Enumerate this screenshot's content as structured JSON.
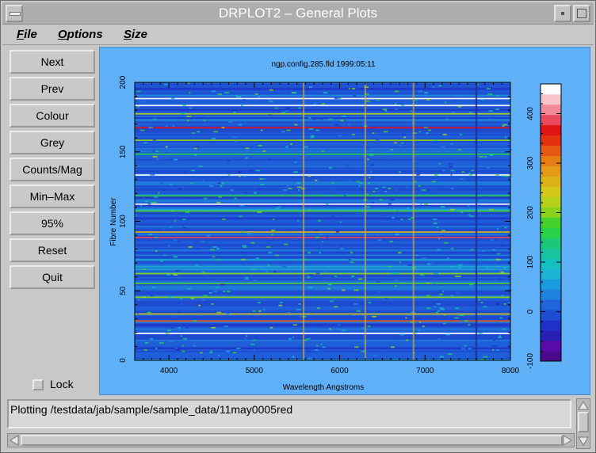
{
  "window": {
    "title": "DRPLOT2 – General Plots"
  },
  "menubar": [
    {
      "label": "File",
      "accel": "F",
      "rest": "ile"
    },
    {
      "label": "Options",
      "accel": "O",
      "rest": "ptions"
    },
    {
      "label": "Size",
      "accel": "S",
      "rest": "ize"
    }
  ],
  "buttons": [
    "Next",
    "Prev",
    "Colour",
    "Grey",
    "Counts/Mag",
    "Min–Max",
    "95%",
    "Reset",
    "Quit"
  ],
  "lock": {
    "label": "Lock",
    "checked": false
  },
  "status": {
    "text": "Plotting /testdata/jab/sample/sample_data/11may0005red"
  },
  "chart_data": {
    "type": "heatmap",
    "title": "ngp.config.285.fld  1999:05:11",
    "xlabel": "Wavelength Angstroms",
    "ylabel": "Fibre Number",
    "xlim": [
      3600,
      8000
    ],
    "ylim": [
      0,
      200
    ],
    "xticks": [
      4000,
      5000,
      6000,
      7000,
      8000
    ],
    "yticks": [
      0,
      50,
      100,
      150,
      200
    ],
    "colorbar": {
      "range": [
        -100,
        460
      ],
      "ticks": [
        -100,
        0,
        100,
        200,
        300,
        400
      ],
      "colors": [
        "#4b0a8c",
        "#5a0aa8",
        "#2a1fb4",
        "#1f32c8",
        "#1e4cd2",
        "#1f64dc",
        "#1e82de",
        "#1c9ae0",
        "#1cb4d6",
        "#14c0be",
        "#18c49e",
        "#1cc878",
        "#2ad24a",
        "#46d22e",
        "#8ad21e",
        "#b4d21c",
        "#d4c81c",
        "#dcb41a",
        "#e49a18",
        "#e67e16",
        "#e45a14",
        "#e23212",
        "#e01414",
        "#e84a5c",
        "#f08a98",
        "#f8c4cc",
        "#ffffff"
      ]
    },
    "bright_fibres": [
      {
        "fibre": 19,
        "level": 460
      },
      {
        "fibre": 28,
        "level": 330
      },
      {
        "fibre": 33,
        "level": 250
      },
      {
        "fibre": 45,
        "level": 210
      },
      {
        "fibre": 55,
        "level": 190
      },
      {
        "fibre": 62,
        "level": 200
      },
      {
        "fibre": 88,
        "level": 380
      },
      {
        "fibre": 92,
        "level": 260
      },
      {
        "fibre": 107,
        "level": 170
      },
      {
        "fibre": 112,
        "level": 460
      },
      {
        "fibre": 118,
        "level": 150
      },
      {
        "fibre": 133,
        "level": 460
      },
      {
        "fibre": 148,
        "level": 160
      },
      {
        "fibre": 158,
        "level": 200
      },
      {
        "fibre": 167,
        "level": 360
      },
      {
        "fibre": 177,
        "level": 220
      },
      {
        "fibre": 183,
        "level": 460
      },
      {
        "fibre": 188,
        "level": 460
      }
    ],
    "sky_lines": [
      5577,
      6300,
      6864,
      7600
    ]
  }
}
